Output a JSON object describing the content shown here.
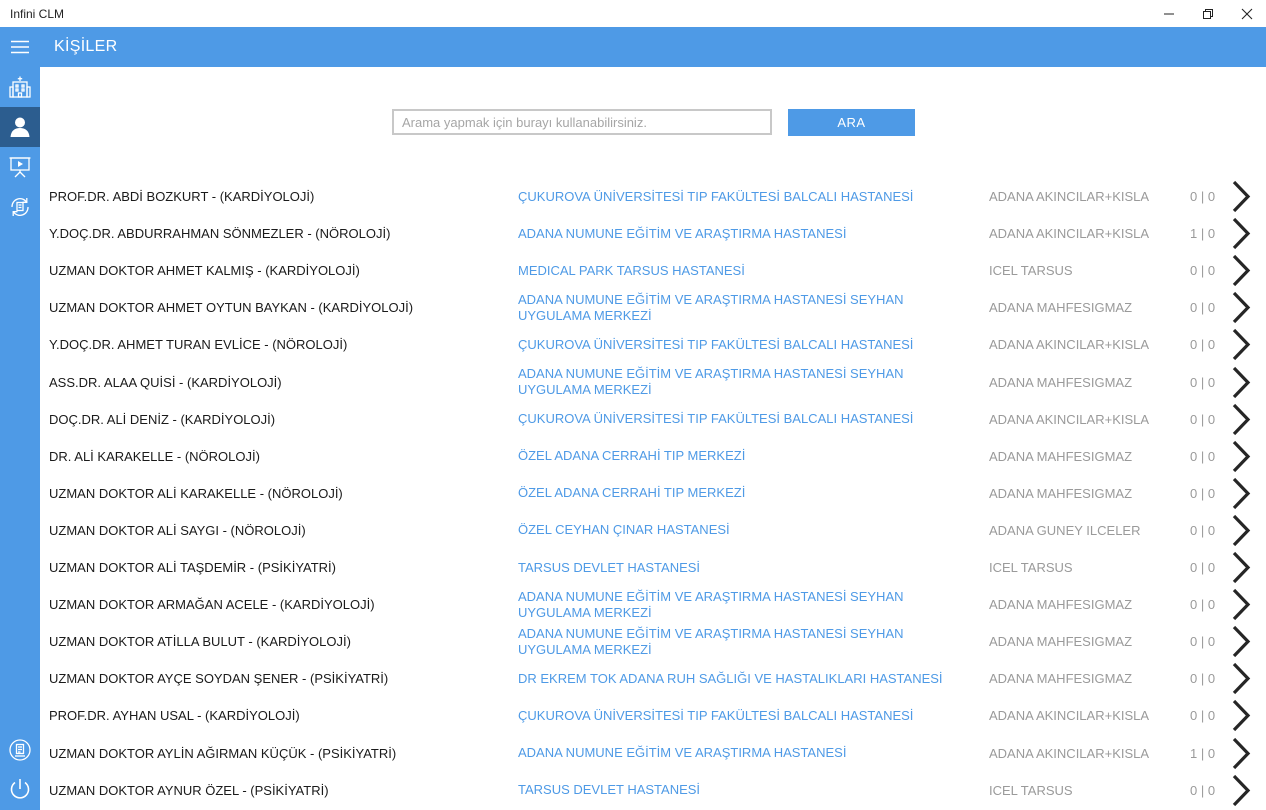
{
  "window": {
    "title": "Infini CLM"
  },
  "appbar": {
    "page_title": "KİŞİLER"
  },
  "sidebar": {
    "items": [
      {
        "icon": "hospital-icon",
        "active": false
      },
      {
        "icon": "person-icon",
        "active": true
      },
      {
        "icon": "presentation-icon",
        "active": false
      },
      {
        "icon": "sync-document-icon",
        "active": false
      }
    ],
    "bottom_items": [
      {
        "icon": "document-icon"
      },
      {
        "icon": "power-icon"
      }
    ]
  },
  "search": {
    "placeholder": "Arama yapmak için burayı kullanabilirsiniz.",
    "value": "",
    "button_label": "ARA"
  },
  "people": [
    {
      "name": "PROF.DR. ABDİ BOZKURT - (KARDİYOLOJİ)",
      "hospital": "ÇUKUROVA ÜNİVERSİTESİ TIP FAKÜLTESİ BALCALI HASTANESİ",
      "region": "ADANA AKINCILAR+KISLA",
      "count": "0 | 0"
    },
    {
      "name": "Y.DOÇ.DR. ABDURRAHMAN SÖNMEZLER - (NÖROLOJİ)",
      "hospital": "ADANA NUMUNE EĞİTİM VE ARAŞTIRMA HASTANESİ",
      "region": "ADANA AKINCILAR+KISLA",
      "count": "1 | 0"
    },
    {
      "name": "UZMAN DOKTOR AHMET KALMIŞ - (KARDİYOLOJİ)",
      "hospital": "MEDICAL PARK TARSUS HASTANESİ",
      "region": "ICEL TARSUS",
      "count": "0 | 0"
    },
    {
      "name": "UZMAN DOKTOR AHMET OYTUN BAYKAN - (KARDİYOLOJİ)",
      "hospital": "ADANA NUMUNE EĞİTİM VE ARAŞTIRMA HASTANESİ SEYHAN UYGULAMA MERKEZİ",
      "region": "ADANA MAHFESIGMAZ",
      "count": "0 | 0"
    },
    {
      "name": "Y.DOÇ.DR. AHMET TURAN EVLİCE - (NÖROLOJİ)",
      "hospital": "ÇUKUROVA ÜNİVERSİTESİ TIP FAKÜLTESİ BALCALI HASTANESİ",
      "region": "ADANA AKINCILAR+KISLA",
      "count": "0 | 0"
    },
    {
      "name": "ASS.DR. ALAA QUİSİ - (KARDİYOLOJİ)",
      "hospital": "ADANA NUMUNE EĞİTİM VE ARAŞTIRMA HASTANESİ SEYHAN UYGULAMA MERKEZİ",
      "region": "ADANA MAHFESIGMAZ",
      "count": "0 | 0"
    },
    {
      "name": "DOÇ.DR. ALİ DENİZ - (KARDİYOLOJİ)",
      "hospital": "ÇUKUROVA ÜNİVERSİTESİ TIP FAKÜLTESİ BALCALI HASTANESİ",
      "region": "ADANA AKINCILAR+KISLA",
      "count": "0 | 0"
    },
    {
      "name": "DR. ALİ KARAKELLE - (NÖROLOJİ)",
      "hospital": "ÖZEL ADANA CERRAHİ TIP MERKEZİ",
      "region": "ADANA MAHFESIGMAZ",
      "count": "0 | 0"
    },
    {
      "name": "UZMAN DOKTOR ALİ KARAKELLE - (NÖROLOJİ)",
      "hospital": "ÖZEL ADANA CERRAHİ TIP MERKEZİ",
      "region": "ADANA MAHFESIGMAZ",
      "count": "0 | 0"
    },
    {
      "name": "UZMAN DOKTOR ALİ SAYGI - (NÖROLOJİ)",
      "hospital": "ÖZEL CEYHAN ÇINAR HASTANESİ",
      "region": "ADANA GUNEY ILCELER",
      "count": "0 | 0"
    },
    {
      "name": "UZMAN DOKTOR ALİ TAŞDEMİR - (PSİKİYATRİ)",
      "hospital": "TARSUS DEVLET HASTANESİ",
      "region": "ICEL TARSUS",
      "count": "0 | 0"
    },
    {
      "name": "UZMAN DOKTOR ARMAĞAN ACELE - (KARDİYOLOJİ)",
      "hospital": "ADANA NUMUNE EĞİTİM VE ARAŞTIRMA HASTANESİ SEYHAN UYGULAMA MERKEZİ",
      "region": "ADANA MAHFESIGMAZ",
      "count": "0 | 0"
    },
    {
      "name": "UZMAN DOKTOR ATİLLA BULUT - (KARDİYOLOJİ)",
      "hospital": "ADANA NUMUNE EĞİTİM VE ARAŞTIRMA HASTANESİ SEYHAN UYGULAMA MERKEZİ",
      "region": "ADANA MAHFESIGMAZ",
      "count": "0 | 0"
    },
    {
      "name": "UZMAN DOKTOR AYÇE SOYDAN ŞENER - (PSİKİYATRİ)",
      "hospital": "DR EKREM TOK ADANA RUH SAĞLIĞI VE HASTALIKLARI HASTANESİ",
      "region": "ADANA MAHFESIGMAZ",
      "count": "0 | 0"
    },
    {
      "name": "PROF.DR. AYHAN USAL - (KARDİYOLOJİ)",
      "hospital": "ÇUKUROVA ÜNİVERSİTESİ TIP FAKÜLTESİ BALCALI HASTANESİ",
      "region": "ADANA AKINCILAR+KISLA",
      "count": "0 | 0"
    },
    {
      "name": "UZMAN DOKTOR AYLİN AĞIRMAN KÜÇÜK - (PSİKİYATRİ)",
      "hospital": "ADANA NUMUNE EĞİTİM VE ARAŞTIRMA HASTANESİ",
      "region": "ADANA AKINCILAR+KISLA",
      "count": "1 | 0"
    },
    {
      "name": "UZMAN DOKTOR AYNUR ÖZEL - (PSİKİYATRİ)",
      "hospital": "TARSUS DEVLET HASTANESİ",
      "region": "ICEL TARSUS",
      "count": "0 | 0"
    }
  ],
  "colors": {
    "accent": "#4e9ae6",
    "active_nav": "#2c5d8f",
    "link": "#4e9ae6",
    "muted": "#9a9a9a"
  }
}
